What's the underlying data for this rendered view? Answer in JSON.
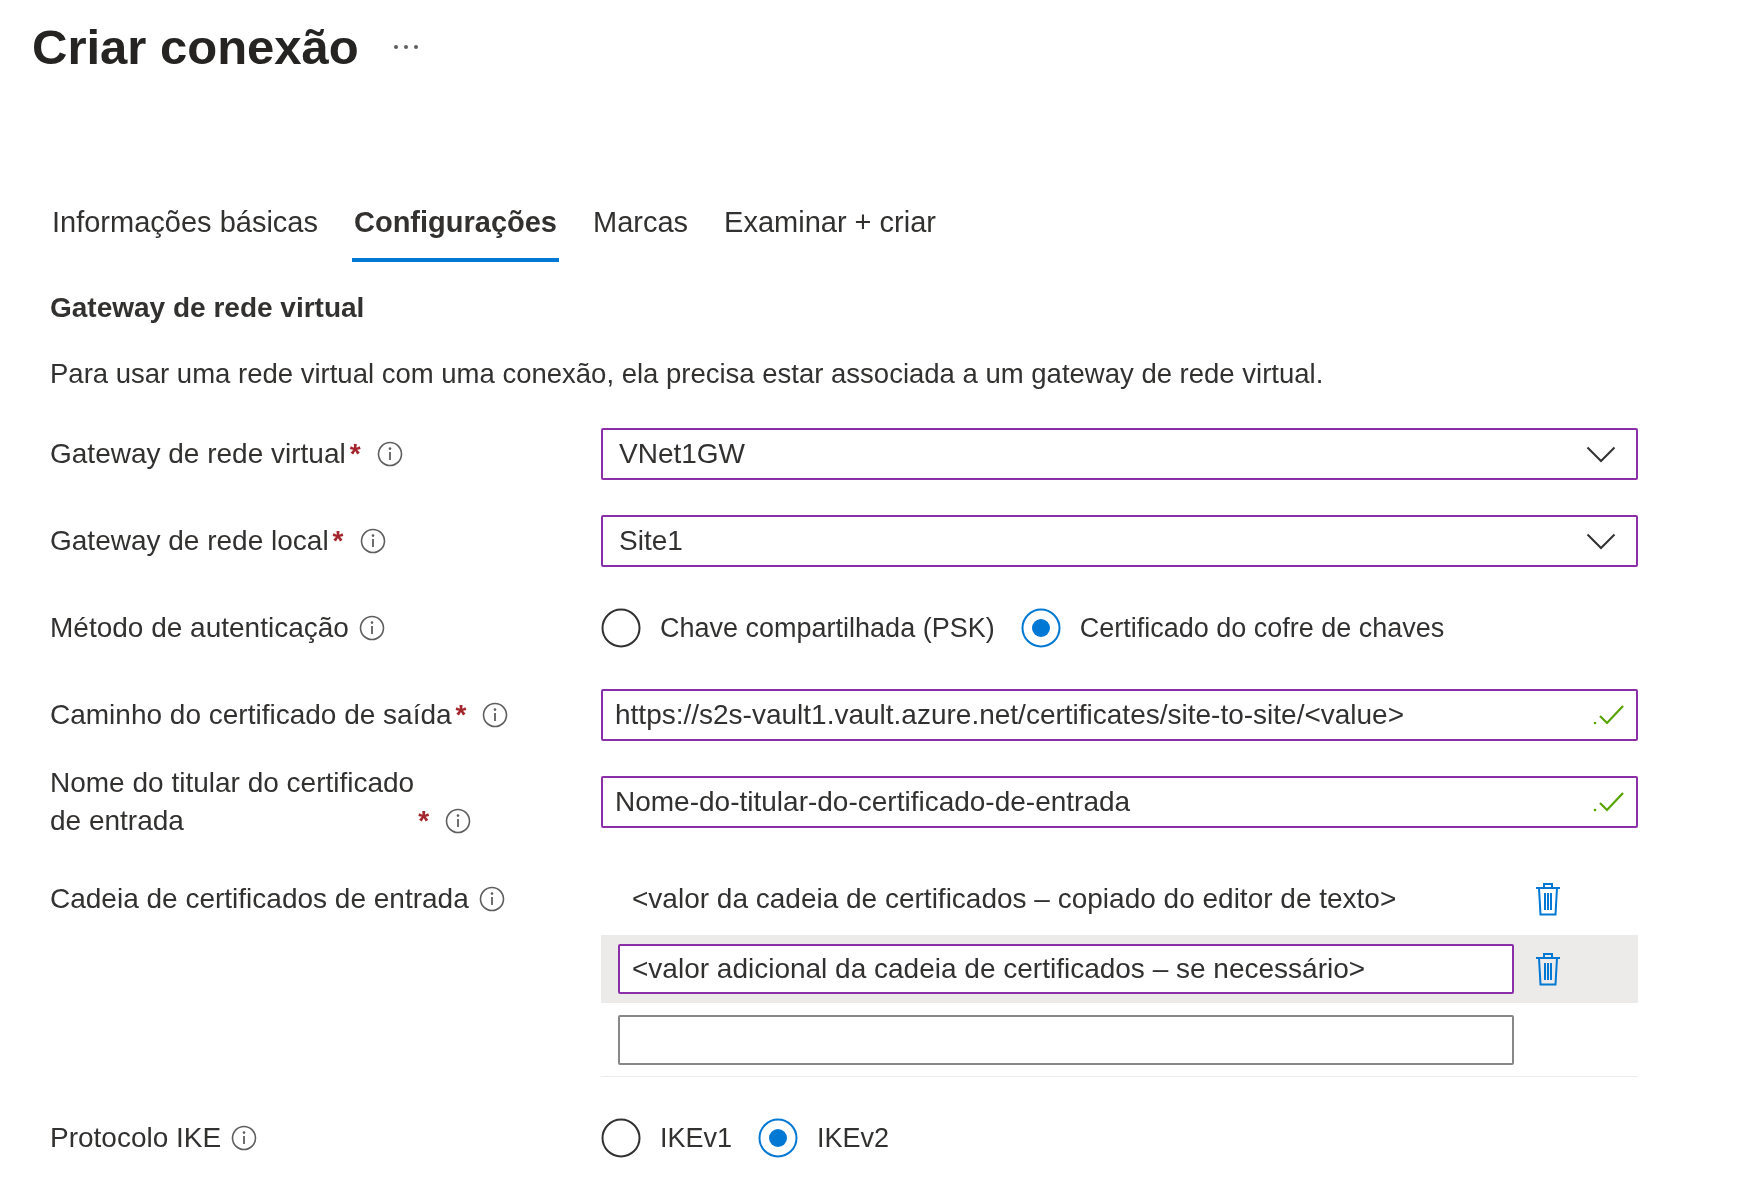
{
  "page": {
    "title": "Criar conexão"
  },
  "tabs": [
    {
      "label": "Informações básicas",
      "selected": false
    },
    {
      "label": "Configurações",
      "selected": true
    },
    {
      "label": "Marcas",
      "selected": false
    },
    {
      "label": "Examinar + criar",
      "selected": false
    }
  ],
  "section": {
    "heading": "Gateway de rede virtual",
    "description": "Para usar uma rede virtual com uma conexão, ela precisa estar associada a um gateway de rede virtual."
  },
  "fields": [
    {
      "kind": "dropdown",
      "label": "Gateway de rede virtual",
      "required_mark": "*",
      "value": "VNet1GW"
    },
    {
      "kind": "dropdown",
      "label": "Gateway de rede local",
      "required_mark": "*",
      "value": "Site1"
    },
    {
      "kind": "radio",
      "label": "Método de autenticação",
      "options": [
        {
          "label": "Chave compartilhada (PSK)",
          "selected": false
        },
        {
          "label": "Certificado do cofre de chaves",
          "selected": true
        }
      ]
    },
    {
      "kind": "text",
      "label": "Caminho do certificado de saída",
      "required_mark": "*",
      "value": "https://s2s-vault1.vault.azure.net/certificates/site-to-site/<value>",
      "valid": true
    },
    {
      "kind": "text",
      "label": "Nome do titular do certificado\nde entrada",
      "required_mark": "*",
      "value": "Nome-do-titular-do-certificado-de-entrada",
      "valid": true
    },
    {
      "kind": "list",
      "label": "Cadeia de certificados de entrada",
      "entries": [
        {
          "value": "<valor da cadeia de certificados – copiado do editor de texto>",
          "focused": false
        },
        {
          "value": "<valor adicional da cadeia de certificados – se necessário>",
          "focused": true
        }
      ]
    },
    {
      "kind": "radio",
      "label": "Protocolo IKE",
      "options": [
        {
          "label": "IKEv1",
          "selected": false
        },
        {
          "label": "IKEv2",
          "selected": true
        }
      ]
    }
  ]
}
